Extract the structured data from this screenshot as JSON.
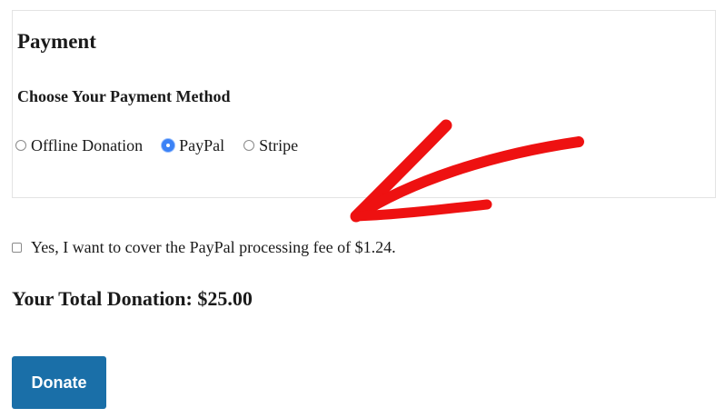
{
  "payment": {
    "title": "Payment",
    "method_heading": "Choose Your Payment Method",
    "options": [
      {
        "label": "Offline Donation",
        "selected": false
      },
      {
        "label": "PayPal",
        "selected": true
      },
      {
        "label": "Stripe",
        "selected": false
      }
    ]
  },
  "fee": {
    "checked": false,
    "label": "Yes, I want to cover the PayPal processing fee of $1.24."
  },
  "total": {
    "text": "Your Total Donation: $25.00"
  },
  "actions": {
    "donate_label": "Donate"
  },
  "colors": {
    "button": "#1a6fa8",
    "radio_selected": "#3b82f6",
    "arrow": "#ee1111"
  },
  "annotation": {
    "icon": "red-arrow-icon"
  }
}
